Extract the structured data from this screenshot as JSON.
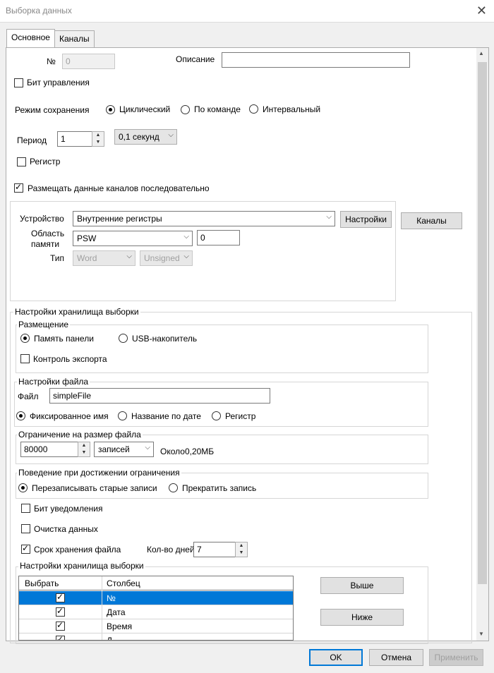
{
  "window": {
    "title": "Выборка данных"
  },
  "tabs": [
    "Основное",
    "Каналы"
  ],
  "basic": {
    "num_label": "№",
    "num_value": "0",
    "desc_label": "Описание",
    "desc_value": "",
    "control_bit_label": "Бит управления",
    "save_mode_label": "Режим сохранения",
    "save_modes": [
      "Циклический",
      "По команде",
      "Интервальный"
    ],
    "period_label": "Период",
    "period_value": "1",
    "period_unit": "0,1 секунд",
    "register_label": "Регистр",
    "sequential_label": "Размещать данные каналов последовательно"
  },
  "device": {
    "device_label": "Устройство",
    "device_value": "Внутренние регистры",
    "settings_button": "Настройки",
    "channels_button": "Каналы",
    "area_label_1": "Область",
    "area_label_2": "памяти",
    "area_value": "PSW",
    "area_offset": "0",
    "type_label": "Тип",
    "type_value": "Word",
    "sign_value": "Unsigned"
  },
  "storage": {
    "title": "Настройки хранилища выборки",
    "placement_title": "Размещение",
    "placement_options": [
      "Память панели",
      "USB-накопитель"
    ],
    "export_control": "Контроль экспорта",
    "file_settings_title": "Настройки файла",
    "file_label": "Файл",
    "file_value": "simpleFile",
    "file_name_options": [
      "Фиксированное имя",
      "Название по дате",
      "Регистр"
    ],
    "limit_title": "Ограничение на размер файла",
    "limit_value": "80000",
    "limit_unit": "записей",
    "limit_info": "Около0,20МБ",
    "behavior_title": "Поведение при достижении ограничения",
    "behavior_options": [
      "Перезаписывать старые записи",
      "Прекратить запись"
    ],
    "notify_bit": "Бит уведомления",
    "clear_data": "Очистка данных",
    "retention": "Срок хранения файла",
    "days_label": "Кол-во дней",
    "days_value": "7"
  },
  "columns": {
    "title": "Настройки хранилища выборки",
    "headers": [
      "Выбрать",
      "Столбец"
    ],
    "rows": [
      "№",
      "Дата",
      "Время",
      "Д"
    ],
    "up_button": "Выше",
    "down_button": "Ниже"
  },
  "footer": {
    "ok": "OK",
    "cancel": "Отмена",
    "apply": "Применить"
  },
  "colors": {
    "accent": "#0078d7"
  }
}
